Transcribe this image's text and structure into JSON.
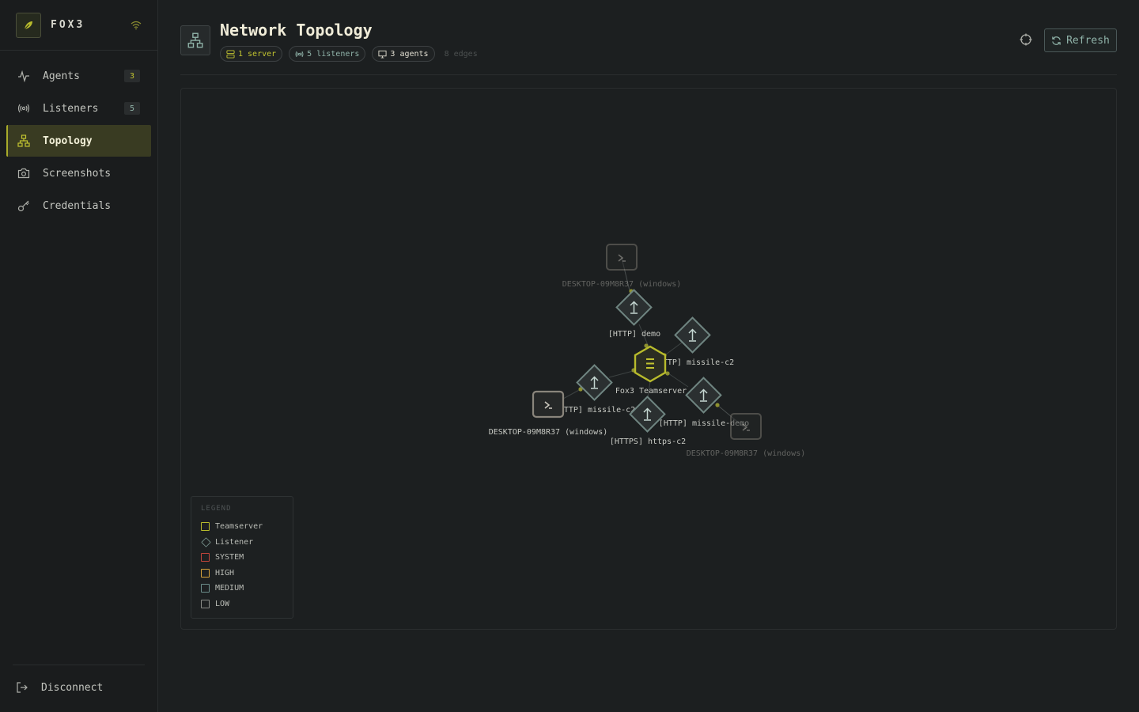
{
  "app": {
    "name": "FOX3"
  },
  "sidebar": {
    "items": [
      {
        "label": "Agents",
        "count": "3",
        "icon": "activity-icon"
      },
      {
        "label": "Listeners",
        "count": "5",
        "icon": "broadcast-icon"
      },
      {
        "label": "Topology",
        "count": "",
        "icon": "network-icon",
        "active": true
      },
      {
        "label": "Screenshots",
        "count": "",
        "icon": "camera-icon"
      },
      {
        "label": "Credentials",
        "count": "",
        "icon": "key-icon"
      }
    ],
    "disconnect_label": "Disconnect"
  },
  "header": {
    "title": "Network Topology",
    "chips": {
      "server": "1 server",
      "listeners": "5 listeners",
      "agents": "3 agents"
    },
    "edges": "8 edges",
    "refresh_label": "Refresh"
  },
  "graph": {
    "nodes": {
      "teamserver": "Fox3 Teamserver",
      "listener_demo": "[HTTP] demo",
      "listener_missile_right": "[HTTP] missile-c2",
      "listener_missile_left": "[HTTP] missile-c2",
      "listener_https": "[HTTPS] https-c2",
      "listener_missile_demo": "[HTTP] missile-demo",
      "agent_top": "DESKTOP-09M8R37 (windows)",
      "agent_left": "DESKTOP-09M8R37 (windows)",
      "agent_right": "DESKTOP-09M8R37 (windows)"
    }
  },
  "legend": {
    "title": "LEGEND",
    "items": [
      {
        "label": "Teamserver",
        "color": "#b8bb2c",
        "shape": "square"
      },
      {
        "label": "Listener",
        "color": "#7e9a94",
        "shape": "diamond"
      },
      {
        "label": "SYSTEM",
        "color": "#c0443a",
        "shape": "square"
      },
      {
        "label": "HIGH",
        "color": "#d6a23a",
        "shape": "square"
      },
      {
        "label": "MEDIUM",
        "color": "#6c8e8a",
        "shape": "square"
      },
      {
        "label": "LOW",
        "color": "#8a8c88",
        "shape": "square"
      }
    ]
  },
  "colors": {
    "accent": "#b8bb2c",
    "listener": "#7e9a94",
    "background": "#1c1f20"
  }
}
